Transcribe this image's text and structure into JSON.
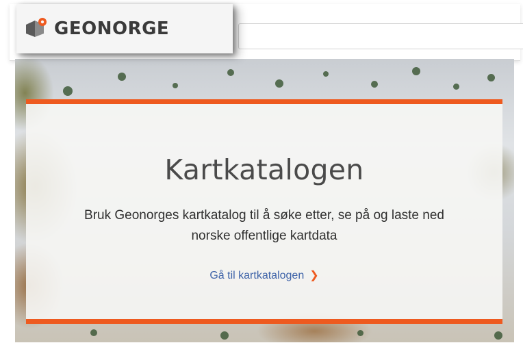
{
  "header": {
    "logo_text": "GEONORGE",
    "search": {
      "value": "",
      "placeholder": ""
    }
  },
  "hero": {
    "title": "Kartkatalogen",
    "description": "Bruk Geonorges kartkatalog til å søke etter, se på og laste ned norske offentlige kartdata",
    "cta_label": "Gå til kartkatalogen",
    "cta_icon": "chevron-right-icon"
  },
  "colors": {
    "accent": "#ee5a1f",
    "link": "#3e63a8",
    "logo_text": "#3a3a3a",
    "title_text": "#4a4a4a"
  }
}
